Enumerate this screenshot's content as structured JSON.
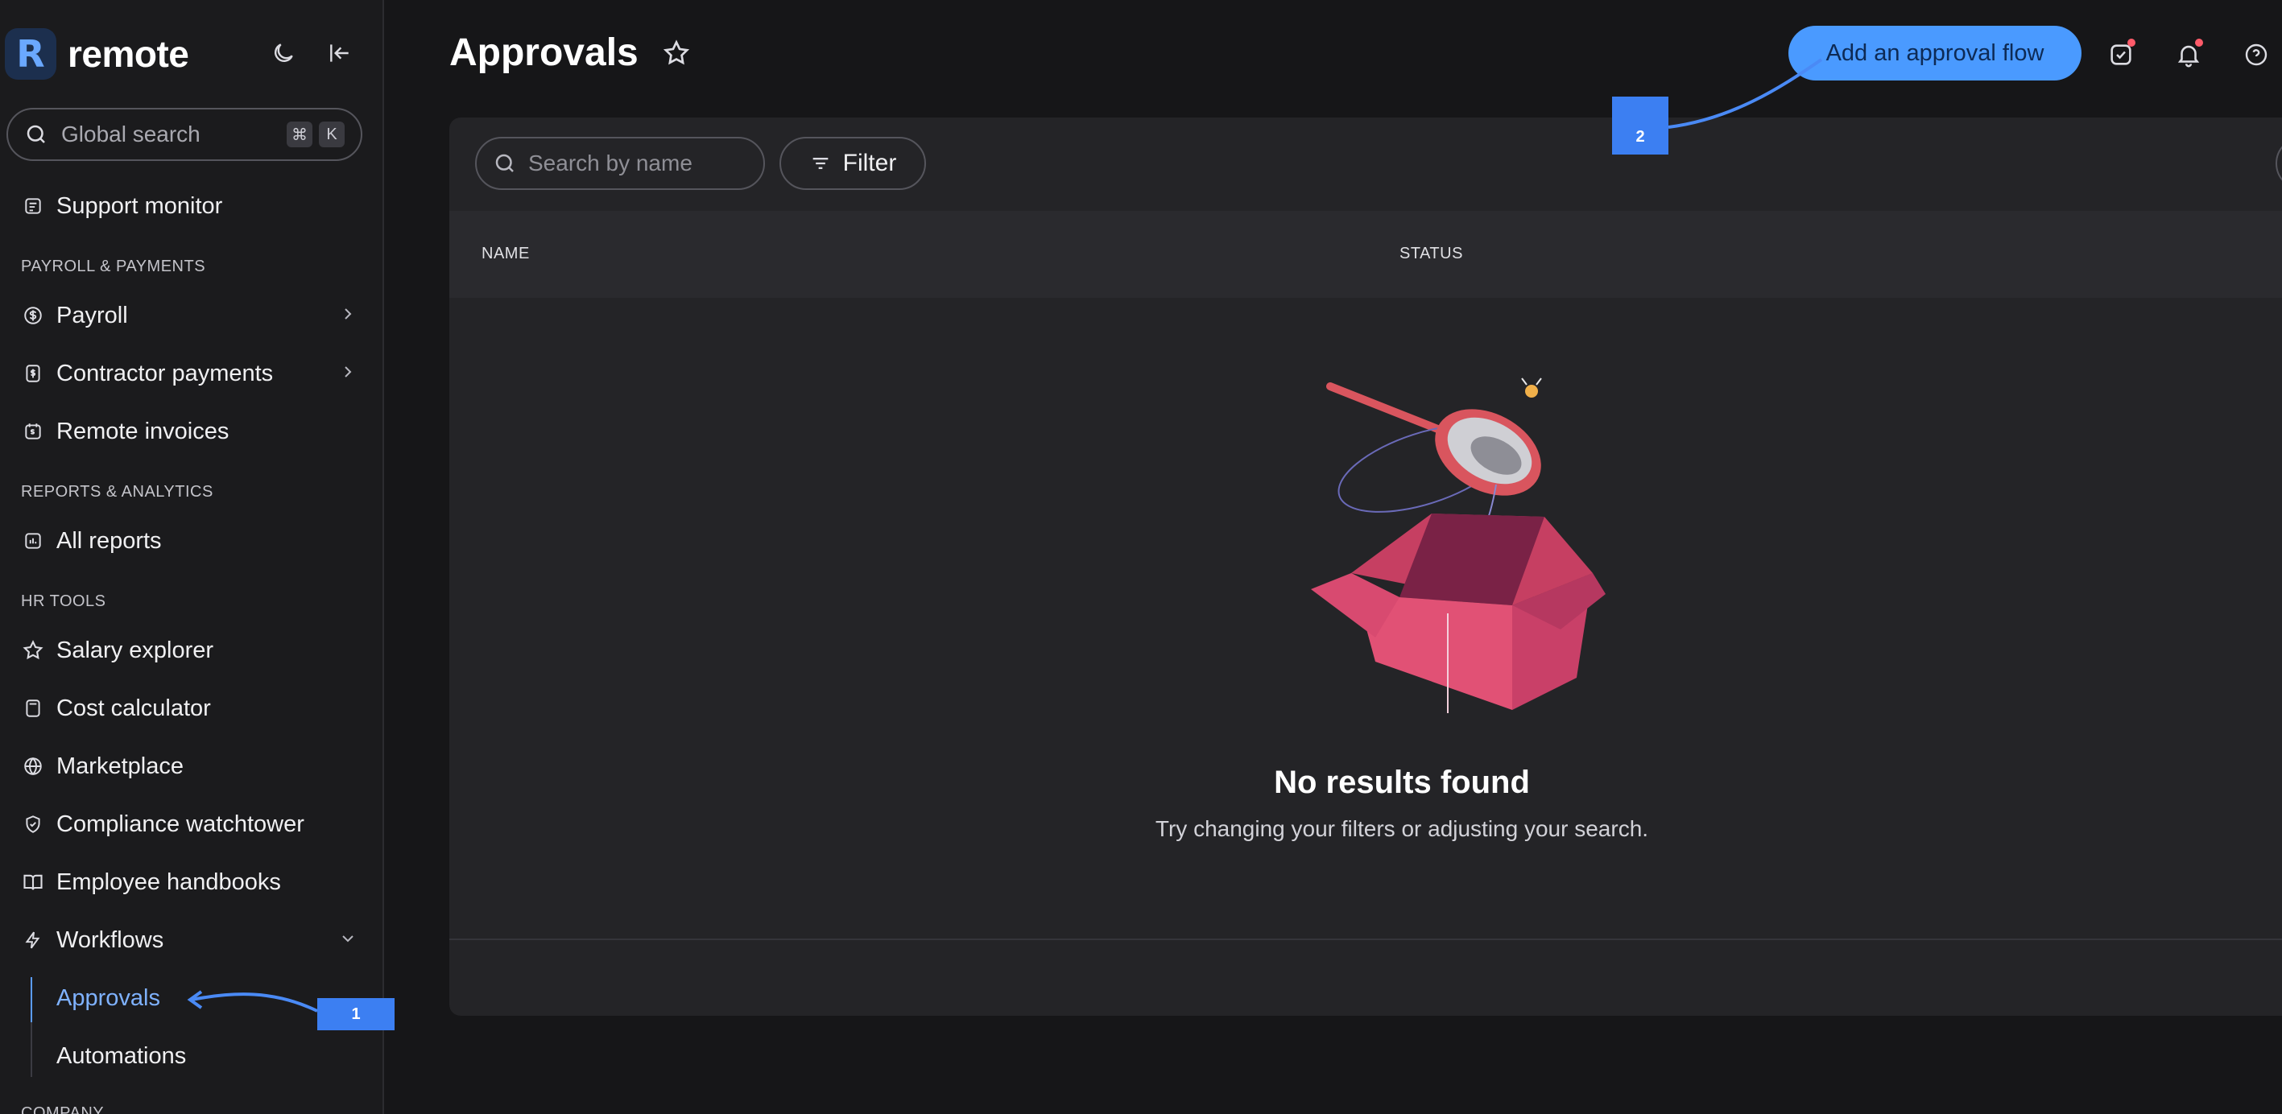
{
  "sidebar": {
    "brand": "remote",
    "brand_initial": "R",
    "global_search": {
      "placeholder": "Global search",
      "shortcut": [
        "⌘",
        "K"
      ]
    },
    "support_monitor": "Support monitor",
    "sections": {
      "payroll": "PAYROLL & PAYMENTS",
      "reports": "REPORTS & ANALYTICS",
      "hr": "HR TOOLS",
      "company": "COMPANY"
    },
    "items": {
      "payroll": "Payroll",
      "contractor_payments": "Contractor payments",
      "remote_invoices": "Remote invoices",
      "all_reports": "All reports",
      "salary_explorer": "Salary explorer",
      "cost_calculator": "Cost calculator",
      "marketplace": "Marketplace",
      "compliance_watchtower": "Compliance watchtower",
      "employee_handbooks": "Employee handbooks",
      "workflows": "Workflows",
      "approvals": "Approvals",
      "automations": "Automations"
    }
  },
  "header": {
    "title": "Approvals",
    "add_button": "Add an approval flow"
  },
  "toolbar": {
    "search_placeholder": "Search by name",
    "filter_label": "Filter"
  },
  "table": {
    "columns": [
      "NAME",
      "STATUS"
    ]
  },
  "empty_state": {
    "title": "No results found",
    "subtitle": "Try changing your filters or adjusting your search."
  },
  "annotations": [
    "1",
    "2"
  ],
  "colors": {
    "accent": "#4a9aff",
    "annotation": "#3c7ff2",
    "active_nav": "#7fb2ff"
  }
}
